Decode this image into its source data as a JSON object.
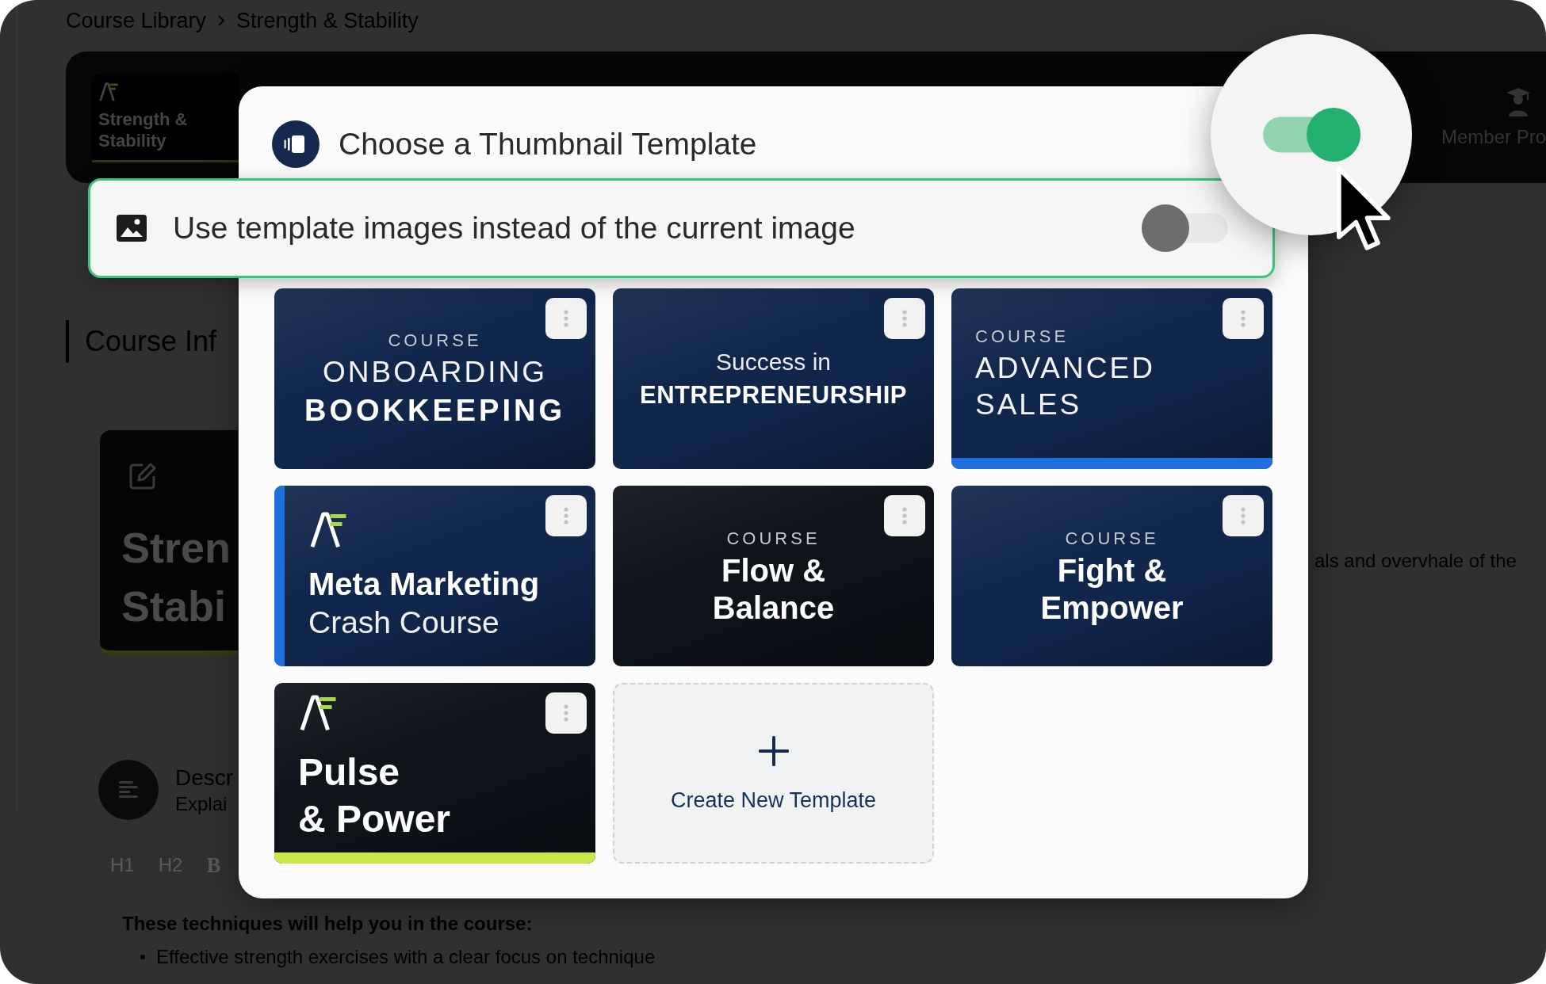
{
  "breadcrumb": [
    {
      "label": "Course Library"
    },
    {
      "label": "Strength & Stability"
    }
  ],
  "header_bar": {
    "course_card": {
      "title": "Strength & Stability"
    },
    "nav_item": {
      "label": "Member Pro"
    }
  },
  "course_info": {
    "section_title": "Course Inf",
    "thumbnail_lines": [
      "Stren",
      "Stabi"
    ],
    "description": {
      "title": "Descr",
      "subtitle": "Explai"
    },
    "side_text": "als and overvhale of the"
  },
  "editor": {
    "toolbar": [
      {
        "label": "H1",
        "kind": "heading"
      },
      {
        "label": "H2",
        "kind": "heading"
      },
      {
        "label": "B",
        "kind": "bold"
      }
    ],
    "heading": "These techniques will help you in the course:",
    "bullets": [
      "Effective strength exercises with a clear focus on technique"
    ]
  },
  "modal": {
    "title": "Choose a Thumbnail Template",
    "templates": [
      {
        "kind": "centered",
        "color": "#10264b",
        "logo": false,
        "lines": [
          {
            "text": "COURSE",
            "kind": "eyebrow"
          },
          {
            "text": "ONBOARDING",
            "kind": "thin"
          },
          {
            "text": "BOOKKEEPING",
            "kind": "spaced"
          }
        ]
      },
      {
        "kind": "centered",
        "color": "#10264b",
        "logo": false,
        "lines": [
          {
            "text": "Success in",
            "kind": "lead"
          },
          {
            "text": "ENTREPRENEURSHIP",
            "kind": "caps"
          }
        ]
      },
      {
        "kind": "left",
        "color": "#10264b",
        "logo": false,
        "accent_bar": {
          "kind": "bottom",
          "color": "#1f6fdf"
        },
        "lines": [
          {
            "text": "COURSE",
            "kind": "eyebrow"
          },
          {
            "text": "ADVANCED",
            "kind": "thin"
          },
          {
            "text": "SALES",
            "kind": "thin"
          }
        ]
      },
      {
        "kind": "left",
        "color": "#10264b",
        "logo": true,
        "accent_bar": {
          "kind": "left",
          "color": "#1f6fdf"
        },
        "lines": [
          {
            "text": "Meta Marketing",
            "kind": "bold"
          },
          {
            "text": "Crash Course",
            "kind": "regular"
          }
        ]
      },
      {
        "kind": "centered",
        "color": "#0e1219",
        "logo": false,
        "lines": [
          {
            "text": "COURSE",
            "kind": "eyebrow"
          },
          {
            "text": "Flow &",
            "kind": "bold"
          },
          {
            "text": "Balance",
            "kind": "bold"
          }
        ]
      },
      {
        "kind": "centered",
        "color": "#10264b",
        "logo": false,
        "lines": [
          {
            "text": "COURSE",
            "kind": "eyebrow"
          },
          {
            "text": "Fight &",
            "kind": "bold"
          },
          {
            "text": "Empower",
            "kind": "bold"
          }
        ]
      },
      {
        "kind": "left",
        "color": "#0e1219",
        "logo": true,
        "accent_bar": {
          "kind": "bottom",
          "color": "#c9e64b"
        },
        "lines": [
          {
            "text": "Pulse",
            "kind": "display"
          },
          {
            "text": "& Power",
            "kind": "display"
          }
        ]
      }
    ],
    "create_button": {
      "label": "Create New Template"
    }
  },
  "setting_callout": {
    "label": "Use template images instead of the current image",
    "on": false
  },
  "magnifier": {
    "toggle": {
      "on": true
    }
  }
}
